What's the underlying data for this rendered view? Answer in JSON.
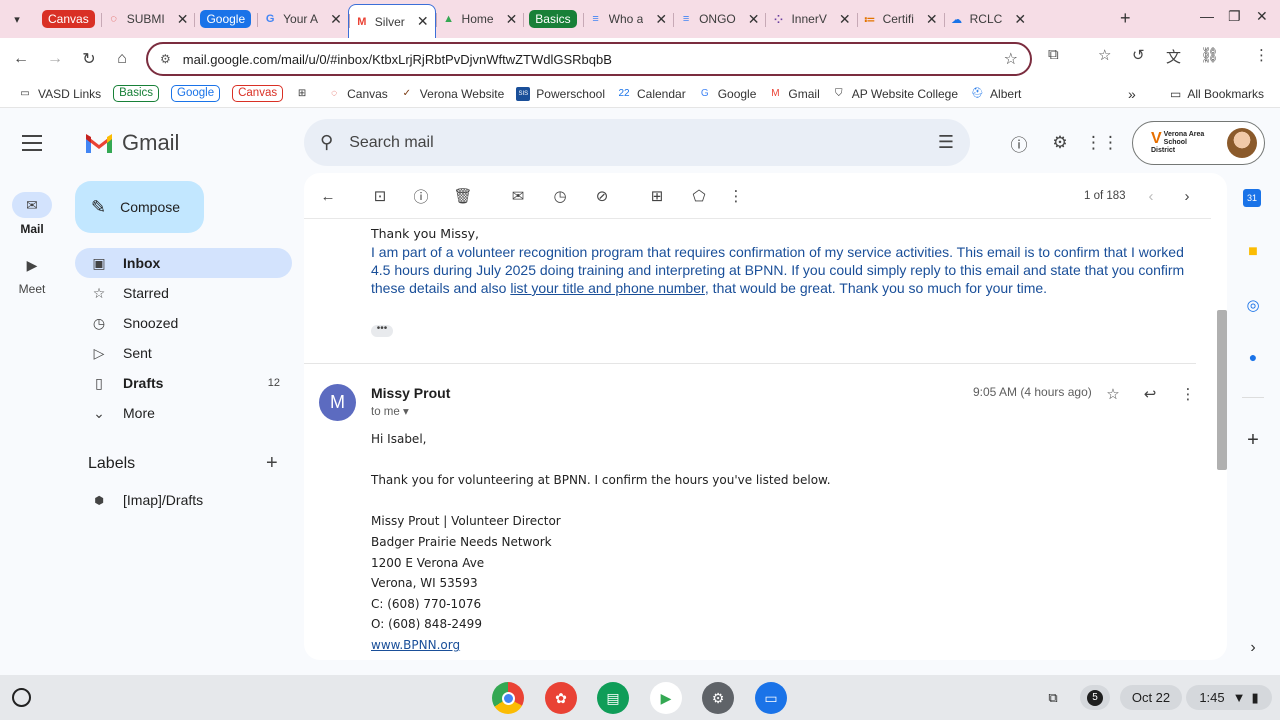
{
  "browser": {
    "tabs": [
      {
        "kind": "pill",
        "label": "Canvas",
        "color": "#d93025"
      },
      {
        "kind": "tab",
        "title": "SUBMI",
        "fav": "◌",
        "favColor": "#d93025"
      },
      {
        "kind": "pill",
        "label": "Google",
        "color": "#1a73e8"
      },
      {
        "kind": "tab",
        "title": "Your A",
        "fav": "G",
        "favColor": "#4285f4"
      },
      {
        "kind": "tab",
        "title": "Silver",
        "fav": "M",
        "favColor": "#ea4335",
        "active": true
      },
      {
        "kind": "tab",
        "title": "Home",
        "fav": "▲",
        "favColor": "#34a853"
      },
      {
        "kind": "pill",
        "label": "Basics",
        "color": "#188038"
      },
      {
        "kind": "tab",
        "title": "Who a",
        "fav": "≡",
        "favColor": "#4285f4"
      },
      {
        "kind": "tab",
        "title": "ONGO",
        "fav": "≡",
        "favColor": "#4285f4"
      },
      {
        "kind": "tab",
        "title": "InnerV",
        "fav": "⁘",
        "favColor": "#6b3fa0"
      },
      {
        "kind": "tab",
        "title": "Certifi",
        "fav": "≔",
        "favColor": "#e37400"
      },
      {
        "kind": "tab",
        "title": "RCLC",
        "fav": "☁",
        "favColor": "#1a73e8"
      }
    ],
    "url": "mail.google.com/mail/u/0/#inbox/KtbxLrjRjRbtPvDjvnWftwZTWdlGSRbqbB",
    "bookmarks": [
      {
        "label": "VASD Links",
        "icon": "▭"
      },
      {
        "label": "Basics",
        "pill": true,
        "color": "#188038"
      },
      {
        "label": "Google",
        "pill": true,
        "color": "#1a73e8"
      },
      {
        "label": "Canvas",
        "pill": true,
        "color": "#d93025"
      },
      {
        "label": "",
        "icon": "⊞"
      },
      {
        "label": "Canvas",
        "icon": "◌",
        "iconColor": "#d93025"
      },
      {
        "label": "Verona Website",
        "icon": "✓",
        "iconColor": "#7a3b12"
      },
      {
        "label": "Powerschool",
        "icon": "SIS",
        "iconColor": "#1a4f99"
      },
      {
        "label": "Calendar",
        "icon": "22",
        "iconColor": "#1a73e8"
      },
      {
        "label": "Google",
        "icon": "G",
        "iconColor": "#4285f4"
      },
      {
        "label": "Gmail",
        "icon": "M",
        "iconColor": "#ea4335"
      },
      {
        "label": "AP Website College",
        "icon": "⛉",
        "iconColor": "#333"
      },
      {
        "label": "Albert",
        "icon": "⛑",
        "iconColor": "#1a73e8"
      }
    ],
    "all_bookmarks": "All Bookmarks"
  },
  "gmail": {
    "app_name": "Gmail",
    "rail": {
      "mail": "Mail",
      "meet": "Meet"
    },
    "search_placeholder": "Search mail",
    "account_org_line1": "Verona Area",
    "account_org_line2": "School District",
    "compose": "Compose",
    "nav": [
      {
        "label": "Inbox",
        "icon": "▣",
        "active": true,
        "count": ""
      },
      {
        "label": "Starred",
        "icon": "☆",
        "count": ""
      },
      {
        "label": "Snoozed",
        "icon": "◷",
        "count": ""
      },
      {
        "label": "Sent",
        "icon": "▷",
        "count": ""
      },
      {
        "label": "Drafts",
        "icon": "▯",
        "bold": true,
        "count": "12"
      },
      {
        "label": "More",
        "icon": "⌄",
        "count": ""
      }
    ],
    "labels_title": "Labels",
    "labels": [
      {
        "label": "[Imap]/Drafts",
        "icon": "◆"
      }
    ],
    "pager": "1 of 183"
  },
  "message": {
    "quoted_greeting": "Thank you Missy,",
    "quoted_text_1": "I am part of a volunteer recognition program that requires confirmation of my service activities. This email is to confirm that I worked 4.5 hours during July 2025 doing training and interpreting at BPNN. If you could simply reply to this email and state that you confirm these details and also ",
    "quoted_link": "list your title and phone number",
    "quoted_text_2": ", that would be great. Thank you so much for your time.",
    "dots": "•••",
    "sender_initial": "M",
    "sender_name": "Missy Prout",
    "to": "to me",
    "time": "9:05 AM (4 hours ago)",
    "greeting": "Hi Isabel,",
    "body": "Thank you for volunteering at BPNN. I confirm the hours you've listed below.",
    "signature": [
      "Missy Prout | Volunteer Director",
      "Badger Prairie Needs Network",
      "1200 E Verona Ave",
      "Verona, WI 53593",
      "C: (608) 770-1076",
      "O: (608) 848-2499"
    ],
    "website": "www.BPNN.org"
  },
  "shelf": {
    "notifications": "5",
    "date": "Oct 22",
    "time": "1:45"
  }
}
